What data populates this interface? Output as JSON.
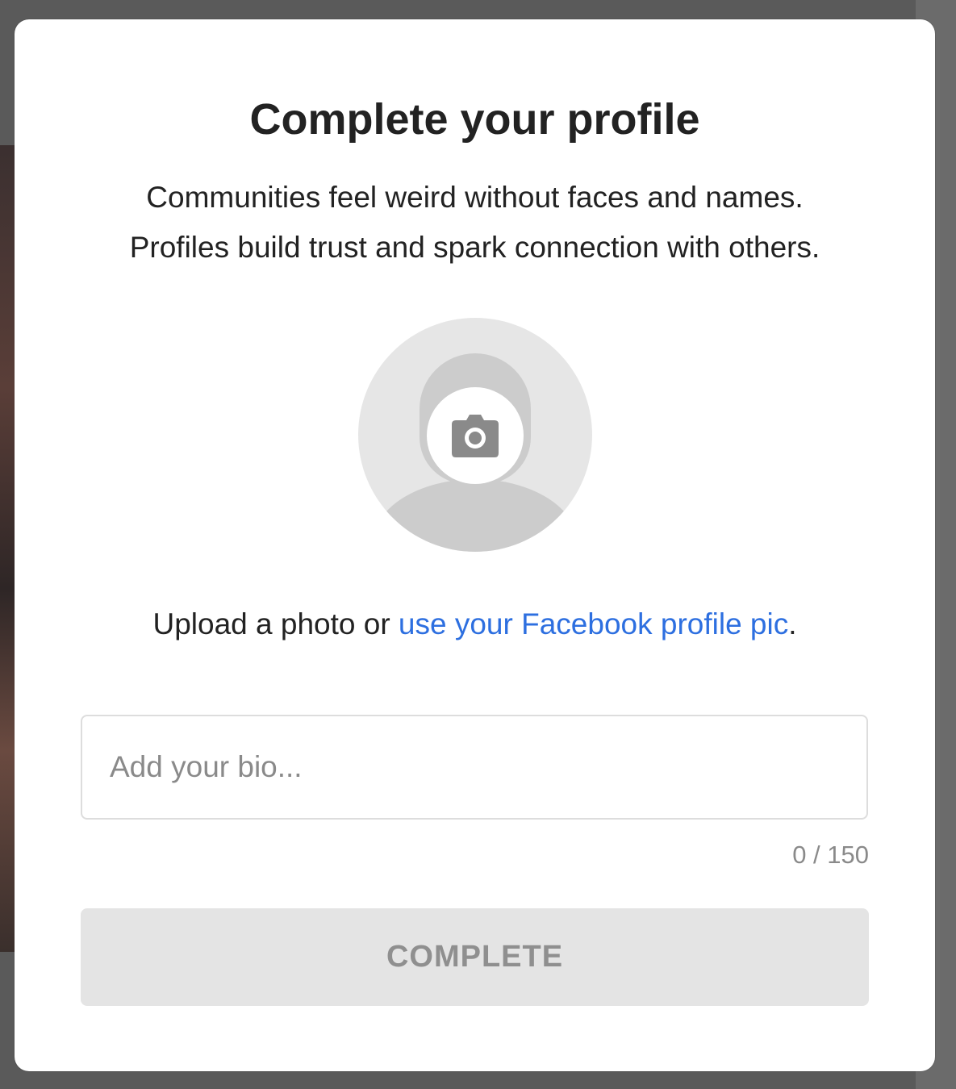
{
  "modal": {
    "title": "Complete your profile",
    "subtitle_lines": [
      "Communities feel weird without faces and names.",
      "Profiles build trust and spark connection with others."
    ],
    "avatar": {
      "placeholder_icon": "person-silhouette-icon",
      "action_icon": "camera-icon"
    },
    "upload": {
      "prefix": "Upload a photo or ",
      "link_text": "use your Facebook profile pic",
      "suffix": "."
    },
    "bio": {
      "value": "",
      "placeholder": "Add your bio...",
      "counter": "0 / 150"
    },
    "complete_button": {
      "label": "COMPLETE",
      "enabled": false
    }
  },
  "colors": {
    "link": "#2d6fe0",
    "title_text": "#222222",
    "muted_text": "#8a8a8a",
    "button_disabled_bg": "#e4e4e4",
    "avatar_bg": "#e6e6e6",
    "avatar_silhouette": "#cccccc",
    "camera_icon": "#8a8a8a",
    "backdrop": "#5a5a5a"
  }
}
